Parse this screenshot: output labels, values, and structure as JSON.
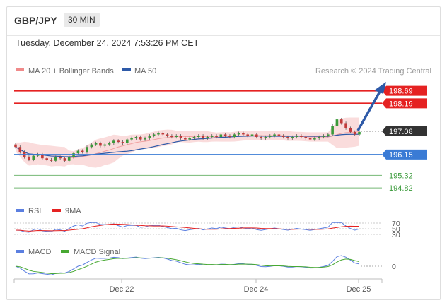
{
  "header": {
    "symbol": "GBP/JPY",
    "interval": "30 MIN"
  },
  "datetime": "Tuesday, December 24, 2024 7:53:26 PM CET",
  "source": "Research © 2024 Trading Central",
  "colors": {
    "resistance": "#e52222",
    "support": "#3a7bd5",
    "pivot": "#333333",
    "target_green": "#3a9a3a",
    "ma50": "#2e5aa8",
    "bollinger": "#f9d6d6",
    "up_candle": "#3a9a3a",
    "down_candle": "#c23a3a",
    "rsi": "#5b7fe0",
    "rsi_ma": "#e52222",
    "macd": "#5b7fe0",
    "macd_signal": "#47a832"
  },
  "chart_data": [
    {
      "type": "line",
      "name": "price",
      "legend": [
        "MA 20 + Bollinger Bands",
        "MA 50"
      ],
      "x": [
        "Dec 22",
        "Dec 24",
        "Dec 25"
      ],
      "ylim": [
        194.6,
        199.1
      ],
      "levels": [
        {
          "label": "198.69",
          "value": 198.69,
          "kind": "resistance"
        },
        {
          "label": "198.19",
          "value": 198.19,
          "kind": "resistance"
        },
        {
          "label": "197.08",
          "value": 197.08,
          "kind": "pivot"
        },
        {
          "label": "196.15",
          "value": 196.15,
          "kind": "support"
        },
        {
          "label": "195.32",
          "value": 195.32,
          "kind": "target"
        },
        {
          "label": "194.82",
          "value": 194.82,
          "kind": "target"
        }
      ],
      "close": [
        196.45,
        196.25,
        196.05,
        195.95,
        196.1,
        196.15,
        196.0,
        195.95,
        195.9,
        196.05,
        196.0,
        195.9,
        196.05,
        196.2,
        196.3,
        196.25,
        196.45,
        196.55,
        196.6,
        196.5,
        196.55,
        196.6,
        196.7,
        196.65,
        196.6,
        196.75,
        196.8,
        196.85,
        196.75,
        196.8,
        196.9,
        196.95,
        197.0,
        196.95,
        196.9,
        196.85,
        196.9,
        196.8,
        196.75,
        196.8,
        196.85,
        196.9,
        196.8,
        196.85,
        196.9,
        196.85,
        196.95,
        196.9,
        196.85,
        196.95,
        197.0,
        196.95,
        196.9,
        196.95,
        196.85,
        196.8,
        196.85,
        196.9,
        196.95,
        196.9,
        196.85,
        196.8,
        196.85,
        196.9,
        196.85,
        196.8,
        196.75,
        196.8,
        196.85,
        196.9,
        196.95,
        197.3,
        197.55,
        197.4,
        197.2,
        197.05,
        196.95,
        197.05
      ]
    },
    {
      "type": "line",
      "name": "rsi",
      "legend": [
        "RSI",
        "9MA"
      ],
      "levels": [
        {
          "label": "70",
          "value": 70
        },
        {
          "label": "50",
          "value": 50
        },
        {
          "label": "30",
          "value": 30
        }
      ],
      "ylim": [
        20,
        80
      ]
    },
    {
      "type": "line",
      "name": "macd",
      "legend": [
        "MACD",
        "MACD Signal"
      ],
      "levels": [
        {
          "label": "0",
          "value": 0
        }
      ]
    }
  ]
}
